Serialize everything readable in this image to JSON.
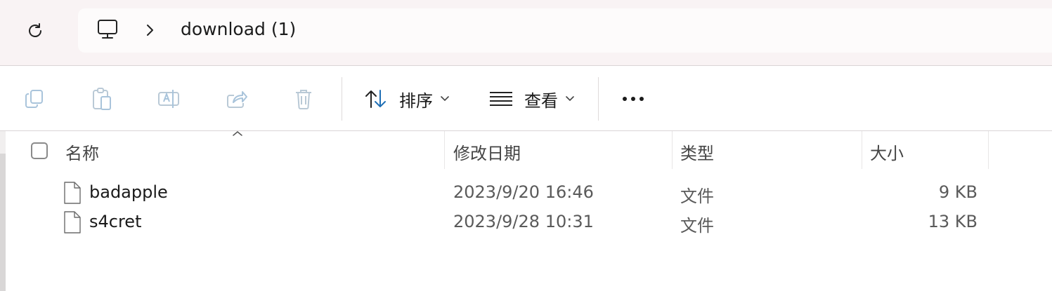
{
  "address_bar": {
    "refresh_icon": "refresh-icon",
    "root_icon": "computer-icon",
    "separator_icon": "chevron-right-icon",
    "current_folder": "download (1)"
  },
  "command_bar": {
    "icons": [
      "copy-icon",
      "paste-icon",
      "rename-icon",
      "share-icon",
      "delete-icon"
    ],
    "sort": {
      "icon": "sort-arrows-icon",
      "label": "排序"
    },
    "view": {
      "icon": "view-lines-icon",
      "label": "查看"
    },
    "more_label": "•••"
  },
  "columns": {
    "name": "名称",
    "modified": "修改日期",
    "type": "类型",
    "size": "大小"
  },
  "files": [
    {
      "name": "badapple",
      "modified": "2023/9/20 16:46",
      "type": "文件",
      "size": "9 KB"
    },
    {
      "name": "s4cret",
      "modified": "2023/9/28 10:31",
      "type": "文件",
      "size": "13 KB"
    }
  ],
  "colors": {
    "titlebar_bg": "#f9f3f4",
    "disabled_icon": "#a9c4db",
    "accent": "#1f6fb5"
  }
}
